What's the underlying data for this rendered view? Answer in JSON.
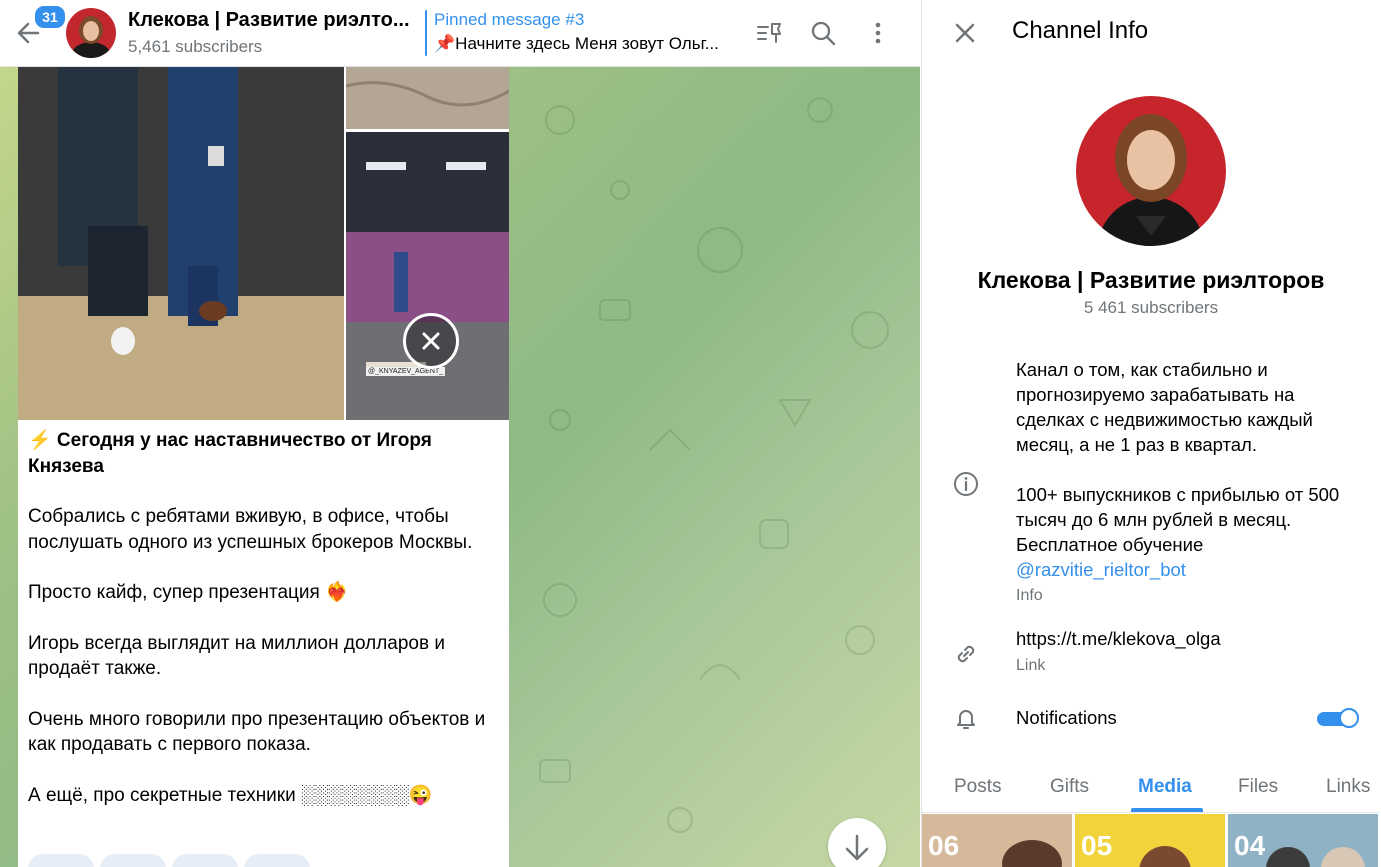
{
  "header": {
    "unread_badge": "31",
    "title": "Клекова | Развитие риэлто...",
    "subscribers": "5,461 subscribers",
    "pinned_title": "Pinned message #3",
    "pinned_text": "📌Начните здесь Меня зовут Ольг..."
  },
  "post": {
    "photo_watermark": "@_KNYAZEV_AGENT_",
    "heading": "⚡ Сегодня у нас наставничество от Игоря Князева",
    "paragraphs": [
      "Собрались с ребятами вживую, в офисе, чтобы послушать одного из успешных брокеров Москвы.",
      "Просто кайф, супер презентация ❤️‍🔥",
      "Игорь всегда выглядит на миллион долларов  и продаёт также.",
      "Очень много говорили про презентацию объектов и как продавать с первого показа.",
      "А ещё, про секретные техники ░░░░░░░░😜"
    ]
  },
  "panel": {
    "title": "Channel Info",
    "channel_name": "Клекова | Развитие риэлторов",
    "subscribers": "5 461 subscribers",
    "description_p1": "Канал о том, как стабильно и прогнозируемо зарабатывать на сделках с недвижимостью каждый месяц, а не 1 раз в квартал.",
    "description_p2": "100+ выпускников с прибылью от 500 тысяч до 6 млн рублей в месяц. Бесплатное обучение",
    "description_link": "@razvitie_rieltor_bot",
    "info_label": "Info",
    "link_value": "https://t.me/klekova_olga",
    "link_label": "Link",
    "notifications_label": "Notifications",
    "notifications_on": true,
    "tabs": [
      "Posts",
      "Gifts",
      "Media",
      "Files",
      "Links"
    ],
    "active_tab": "Media",
    "media_thumbs": [
      "06",
      "05",
      "04"
    ]
  },
  "colors": {
    "accent": "#3390ec",
    "secondary_text": "#707579"
  }
}
